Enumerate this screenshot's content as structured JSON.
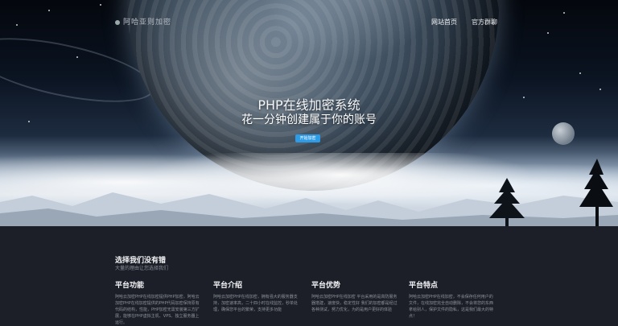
{
  "header": {
    "logo_text": "阿哈亚则加密",
    "nav": [
      "网站首页",
      "官方群聊"
    ]
  },
  "hero": {
    "title": "PHP在线加密系统",
    "subtitle": "花一分钟创建属于你的账号",
    "button_label": "开始加密"
  },
  "section": {
    "title": "选择我们没有错",
    "subtitle": "大量的理由让您选择我们",
    "columns": [
      {
        "title": "平台功能",
        "text": "阿哈云加密PHP在线加密提供PHP加密，阿哈云加密PHP在线加密提供的PHP代码加密保持原有代码的结构，性能，PHP加密无需安装第三方扩展，能够在PHP虚拟主机、VPS、独立服务器上运行。"
      },
      {
        "title": "平台介绍",
        "text": "阿哈云加密PHP在线加密，拥有强大的服务器支持，加密速率高，二十四小时在线监控，秒单处理，确保您平台的繁荣，支持更多功能"
      },
      {
        "title": "平台优势",
        "text": "阿哈云加密PHP在线加密 平台采用的是高防服务器搭建，速度快，稳定性好 我们的加密都是经过各种测试，努力优化，为的是用户更好的体验"
      },
      {
        "title": "平台特点",
        "text": "阿哈云加密PHP在线加密，不会保存任何用户的文件，在线加密完全自动删除，不会将您的东西拿给别人，保护文件的隐私，这是我们最大的特点！"
      }
    ]
  }
}
